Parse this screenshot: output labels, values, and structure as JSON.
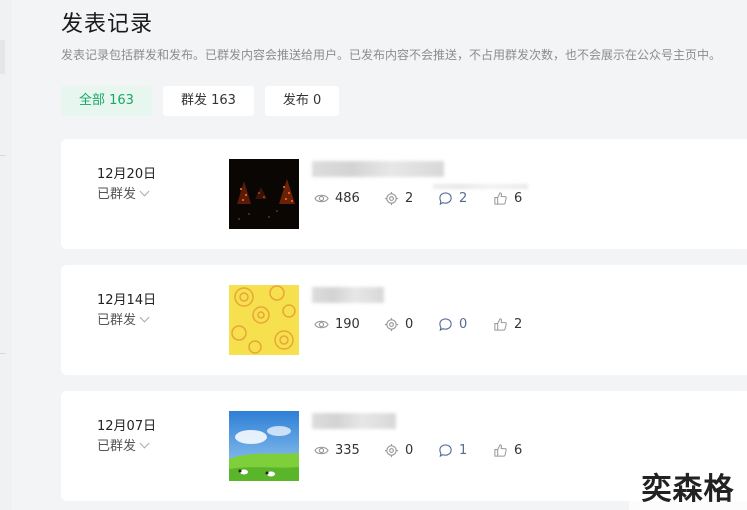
{
  "page": {
    "title": "发表记录",
    "description": "发表记录包括群发和发布。已群发内容会推送给用户。已发布内容不会推送，不占用群发次数，也不会展示在公众号主页中。"
  },
  "tabs": [
    {
      "label": "全部 163",
      "active": true
    },
    {
      "label": "群发 163",
      "active": false
    },
    {
      "label": "发布 0",
      "active": false
    }
  ],
  "colors": {
    "accent": "#19a864",
    "link_blue": "#576b95"
  },
  "posts": [
    {
      "date": "12月20日",
      "status": "已群发",
      "views": "486",
      "shares": "2",
      "comments": "2",
      "likes": "6",
      "thumb": "dark-tree-lights"
    },
    {
      "date": "12月14日",
      "status": "已群发",
      "views": "190",
      "shares": "0",
      "comments": "0",
      "likes": "2",
      "thumb": "yellow-pattern"
    },
    {
      "date": "12月07日",
      "status": "已群发",
      "views": "335",
      "shares": "0",
      "comments": "1",
      "likes": "6",
      "thumb": "sky-meadow"
    }
  ],
  "watermark": "奕森格"
}
